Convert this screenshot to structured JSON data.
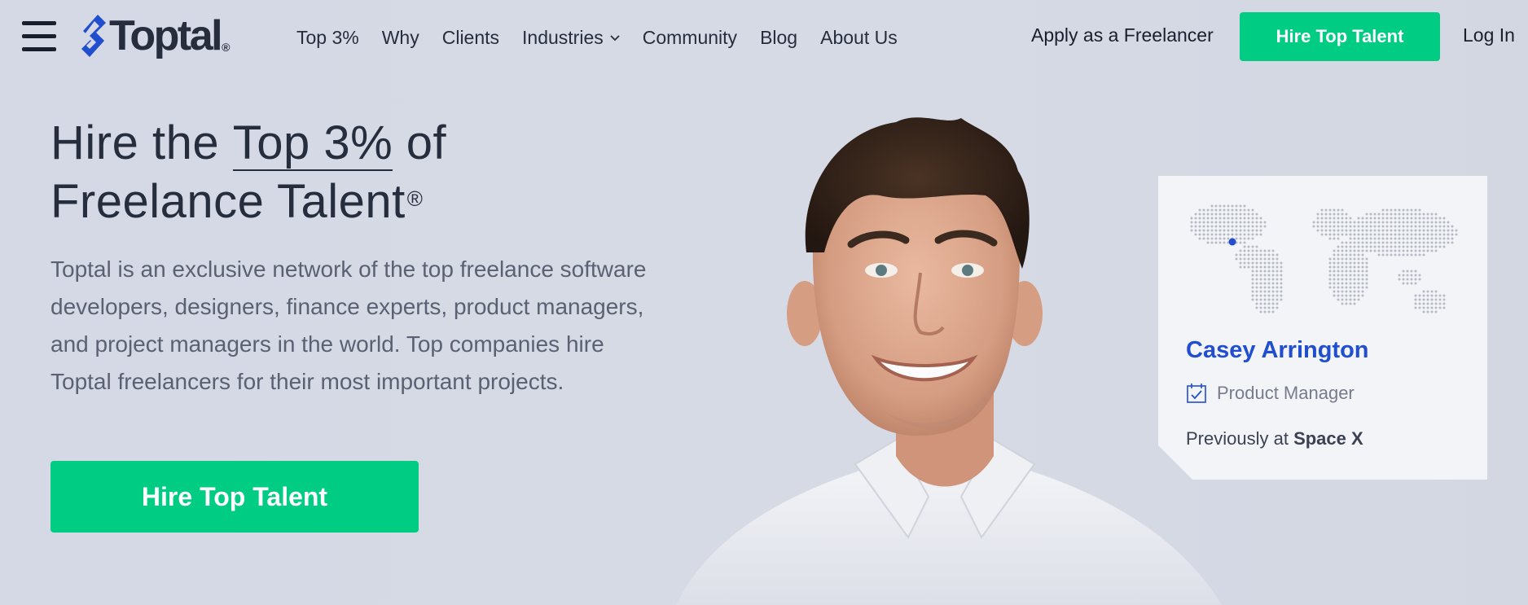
{
  "header": {
    "logo_text": "Toptal",
    "logo_reg": "®",
    "nav": [
      {
        "label": "Top 3%"
      },
      {
        "label": "Why"
      },
      {
        "label": "Clients"
      },
      {
        "label": "Industries"
      },
      {
        "label": "Community"
      },
      {
        "label": "Blog"
      },
      {
        "label": "About Us"
      }
    ],
    "apply_label": "Apply as a Freelancer",
    "hire_label": "Hire Top Talent",
    "login_label": "Log In"
  },
  "hero": {
    "title_part1": "Hire the ",
    "title_highlight": "Top 3%",
    "title_part2": " of",
    "title_line2": "Freelance Talent",
    "title_reg": "®",
    "description": "Toptal is an exclusive network of the top freelance software developers, designers, finance experts, product managers, and project managers in the world. Top companies hire Toptal freelancers for their most important projects.",
    "cta_label": "Hire Top Talent"
  },
  "profile_card": {
    "name": "Casey Arrington",
    "role": "Product Manager",
    "previously_prefix": "Previously at ",
    "previously_company": "Space X"
  },
  "colors": {
    "accent_green": "#00cc83",
    "brand_blue": "#204ecf",
    "background": "#d5d9e5",
    "text_dark": "#262d3d"
  },
  "icons": {
    "menu": "hamburger-menu-icon",
    "logo": "toptal-logo-icon",
    "chevron": "chevron-down-icon",
    "role": "calendar-check-icon",
    "map": "world-map-icon"
  }
}
